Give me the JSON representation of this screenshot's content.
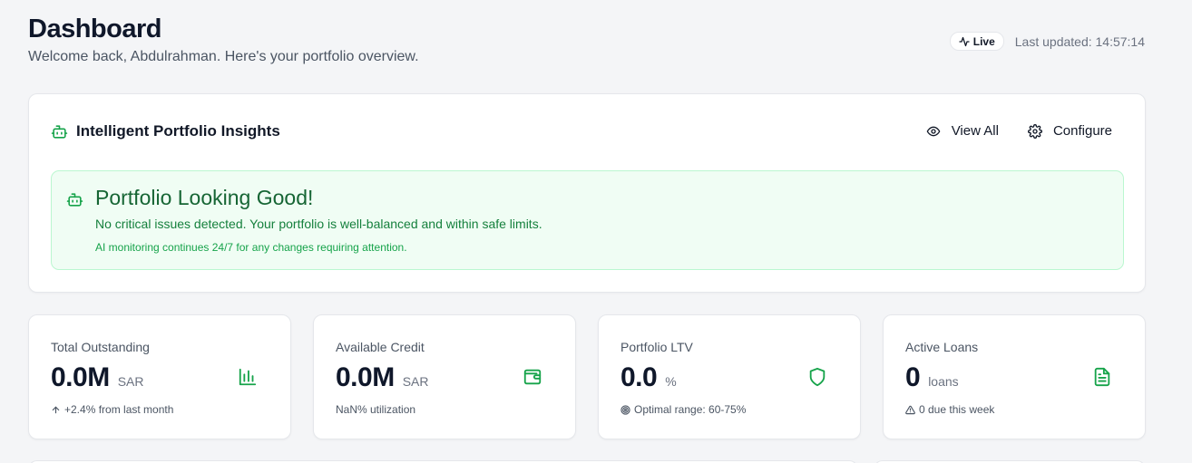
{
  "header": {
    "title": "Dashboard",
    "subtitle": "Welcome back, Abdulrahman. Here's your portfolio overview.",
    "live_label": "Live",
    "last_updated": "Last updated: 14:57:14"
  },
  "insights": {
    "title": "Intelligent Portfolio Insights",
    "view_all_label": "View All",
    "configure_label": "Configure",
    "status": {
      "title": "Portfolio Looking Good!",
      "description": "No critical issues detected. Your portfolio is well-balanced and within safe limits.",
      "note": "AI monitoring continues 24/7 for any changes requiring attention."
    }
  },
  "stats": [
    {
      "label": "Total Outstanding",
      "value": "0.0M",
      "unit": "SAR",
      "foot": "+2.4% from last month",
      "icon": "bar-chart-icon",
      "foot_icon": "arrow-up-icon"
    },
    {
      "label": "Available Credit",
      "value": "0.0M",
      "unit": "SAR",
      "foot": "NaN% utilization",
      "icon": "wallet-icon",
      "foot_icon": ""
    },
    {
      "label": "Portfolio LTV",
      "value": "0.0",
      "unit": "%",
      "foot": "Optimal range: 60-75%",
      "icon": "shield-icon",
      "foot_icon": "target-icon"
    },
    {
      "label": "Active Loans",
      "value": "0",
      "unit": "loans",
      "foot": "0 due this week",
      "icon": "document-icon",
      "foot_icon": "warning-icon"
    }
  ],
  "colors": {
    "accent_green": "#16a34a",
    "success_bg": "#f0fdf4",
    "success_border": "#bbf7d0",
    "page_bg": "#f4f5f7"
  }
}
